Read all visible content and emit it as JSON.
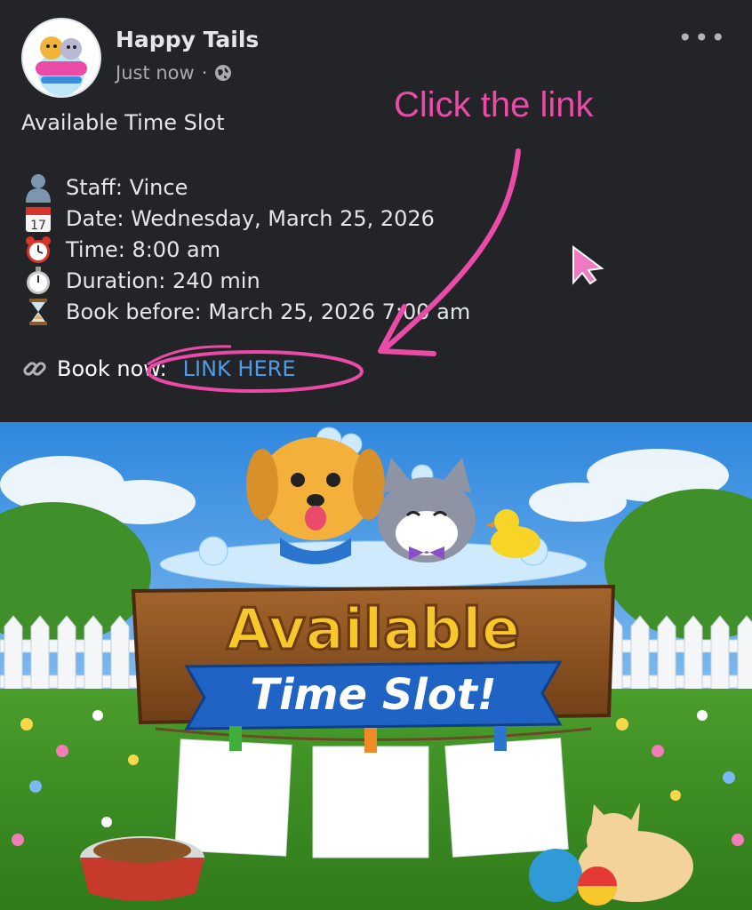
{
  "header": {
    "page_name": "Happy Tails",
    "timestamp": "Just now",
    "separator": "·",
    "more_label": "•••"
  },
  "post": {
    "title": "Available Time Slot",
    "details": [
      {
        "icon": "bust-silhouette-icon",
        "text": "Staff: Vince"
      },
      {
        "icon": "calendar-icon",
        "text": "Date: Wednesday, March 25, 2026"
      },
      {
        "icon": "alarm-clock-icon",
        "text": "Time: 8:00 am"
      },
      {
        "icon": "stopwatch-icon",
        "text": "Duration: 240 min"
      },
      {
        "icon": "hourglass-icon",
        "text": "Book before: March 25, 2026 7:00 am"
      }
    ],
    "book_label": "Book now:",
    "link_text": "LINK HERE"
  },
  "annotation": {
    "text": "Click the link",
    "color": "#e94ba6"
  },
  "banner": {
    "sign_line1": "Available",
    "sign_line2": "Time Slot!",
    "calendar_day": "17"
  },
  "colors": {
    "background": "#232427",
    "link": "#4e9be8",
    "annotation": "#e94ba6",
    "sign_yellow": "#f7c82c",
    "ribbon_blue": "#1f63c4"
  }
}
